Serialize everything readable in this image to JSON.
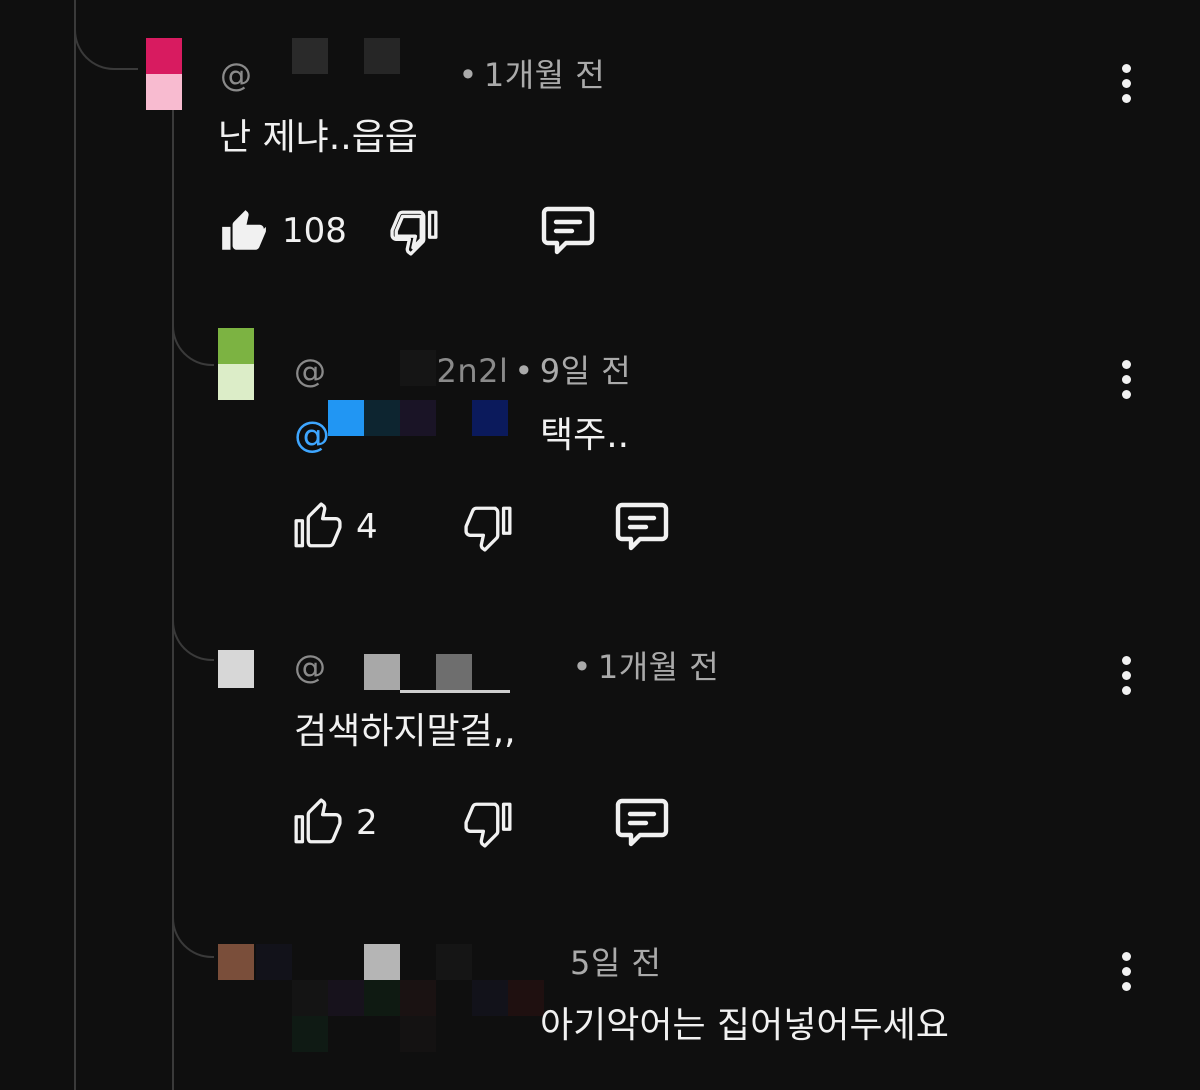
{
  "comments": [
    {
      "handle": "@",
      "dot": "•",
      "time": "1개월 전",
      "text": "난 제냐..읍읍",
      "likes": "108",
      "avatar_colors": [
        "#d81b60",
        "#f8bbd0"
      ],
      "liked": true
    },
    {
      "handle": "@",
      "handle_tail": "2n2l",
      "dot": "•",
      "time": "9일 전",
      "mention": "@",
      "text": "택주..",
      "likes": "4",
      "avatar_colors": [
        "#7cb342",
        "#dcedc8"
      ]
    },
    {
      "handle": "@",
      "dot": "•",
      "time": "1개월 전",
      "text": "검색하지말걸,,",
      "likes": "2",
      "avatar_colors": [
        "#d7d7d7",
        "#d7d7d7"
      ]
    },
    {
      "time": "5일 전",
      "text": "아기악어는 집어넣어두세요",
      "avatar_colors": [
        "#7a4e3a",
        "#7a4e3a"
      ]
    }
  ],
  "icons": {
    "like": "thumbs-up-icon",
    "dislike": "thumbs-down-icon",
    "reply": "reply-comment-icon",
    "more": "more-vertical-icon"
  }
}
